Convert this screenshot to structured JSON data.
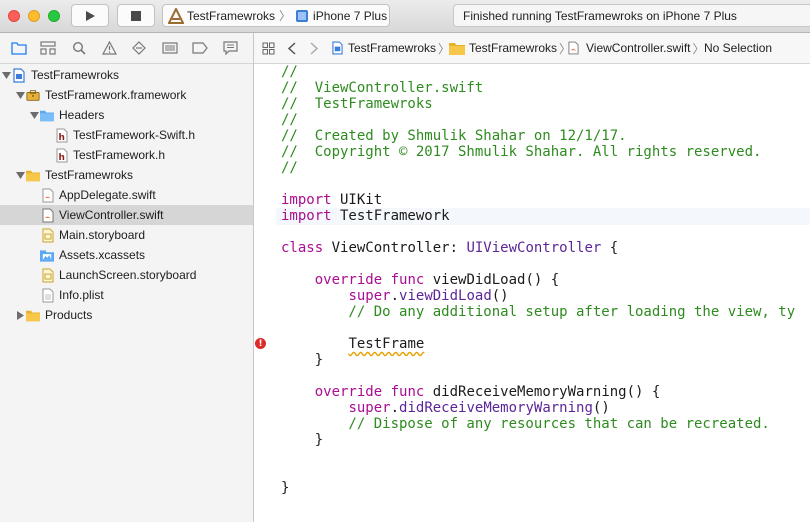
{
  "toolbar": {
    "scheme": {
      "target": "TestFramewroks",
      "device": "iPhone 7 Plus"
    },
    "activity": "Finished running TestFramewroks on iPhone 7 Plus"
  },
  "jumpbar": {
    "items": [
      "TestFramewroks",
      "TestFramewroks",
      "ViewController.swift",
      "No Selection"
    ]
  },
  "navigator": {
    "tabs": [
      "folder-icon",
      "hierarchy-icon",
      "search-icon",
      "warning-icon",
      "test-diamond-icon",
      "list-icon",
      "breakpoint-icon",
      "report-icon"
    ],
    "tree": [
      {
        "label": "TestFramewroks",
        "icon": "project-icon",
        "level": 0,
        "expanded": true
      },
      {
        "label": "TestFramework.framework",
        "icon": "framework-icon",
        "level": 1,
        "expanded": true
      },
      {
        "label": "Headers",
        "icon": "blue-folder-icon",
        "level": 2,
        "expanded": true
      },
      {
        "label": "TestFramework-Swift.h",
        "icon": "header-file-icon",
        "level": 3
      },
      {
        "label": "TestFramework.h",
        "icon": "header-file-icon",
        "level": 3
      },
      {
        "label": "TestFramewroks",
        "icon": "yellow-folder-icon",
        "level": 1,
        "expanded": true
      },
      {
        "label": "AppDelegate.swift",
        "icon": "swift-file-icon",
        "level": 2
      },
      {
        "label": "ViewController.swift",
        "icon": "swift-file-icon",
        "level": 2,
        "selected": true
      },
      {
        "label": "Main.storyboard",
        "icon": "storyboard-icon",
        "level": 2
      },
      {
        "label": "Assets.xcassets",
        "icon": "assets-icon",
        "level": 2
      },
      {
        "label": "LaunchScreen.storyboard",
        "icon": "storyboard-icon",
        "level": 2
      },
      {
        "label": "Info.plist",
        "icon": "plist-icon",
        "level": 2
      },
      {
        "label": "Products",
        "icon": "yellow-folder-icon",
        "level": 1,
        "expanded": false
      }
    ]
  },
  "editor": {
    "lines": [
      "//",
      "//  ViewController.swift",
      "//  TestFramewroks",
      "//",
      "//  Created by Shmulik Shahar on 12/1/17.",
      "//  Copyright © 2017 Shmulik Shahar. All rights reserved.",
      "//",
      "",
      "import UIKit",
      "import TestFramework",
      "",
      "class ViewController: UIViewController {",
      "",
      "    override func viewDidLoad() {",
      "        super.viewDidLoad()",
      "        // Do any additional setup after loading the view, ty",
      "",
      "        TestFrame",
      "    }",
      "",
      "    override func didReceiveMemoryWarning() {",
      "        super.didReceiveMemoryWarning()",
      "        // Dispose of any resources that can be recreated.",
      "    }",
      "",
      "",
      "}"
    ],
    "error_glyph": "!",
    "error_line": 18
  },
  "colors": {
    "comment": "#2e8b1f",
    "keyword": "#aa0d91",
    "type": "#5c2699",
    "selection_row": "#d6d6d6",
    "accent": "#1e7cf3"
  }
}
